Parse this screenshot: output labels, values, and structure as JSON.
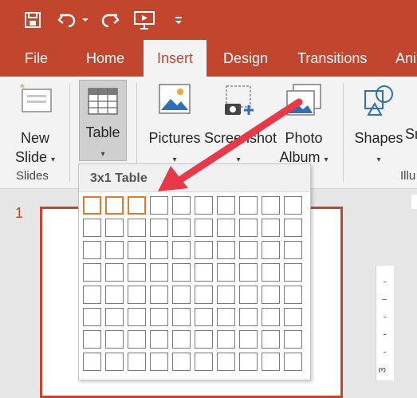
{
  "quick_access": {
    "icons": [
      "save-icon",
      "undo-icon",
      "undo-dropdown-icon",
      "redo-icon",
      "start-from-beginning-icon",
      "customize-qat-icon"
    ]
  },
  "tabs": [
    {
      "label": "File",
      "active": false
    },
    {
      "label": "Home",
      "active": false
    },
    {
      "label": "Insert",
      "active": true
    },
    {
      "label": "Design",
      "active": false
    },
    {
      "label": "Transitions",
      "active": false
    },
    {
      "label": "Ani",
      "active": false
    }
  ],
  "ribbon": {
    "new_slide": {
      "line1": "New",
      "line2": "Slide"
    },
    "table": {
      "label": "Table"
    },
    "pictures": {
      "label": "Pictures"
    },
    "screenshot": {
      "label": "Screenshot"
    },
    "photo_album": {
      "line1": "Photo",
      "line2": "Album"
    },
    "shapes": {
      "label": "Shapes"
    },
    "smartart_partial": "Sr",
    "groups": {
      "slides": "Slides",
      "illustrations_partial": "Illu"
    }
  },
  "table_dropdown": {
    "title": "3x1 Table",
    "columns": 10,
    "rows": 8,
    "selected_columns": 3,
    "selected_rows": 1
  },
  "slide_pane": {
    "slide_number": "1"
  },
  "ruler": {
    "number": "3"
  },
  "colors": {
    "accent": "#c2452d",
    "selection": "#e07a2f",
    "annotation_arrow": "#e8394a"
  }
}
